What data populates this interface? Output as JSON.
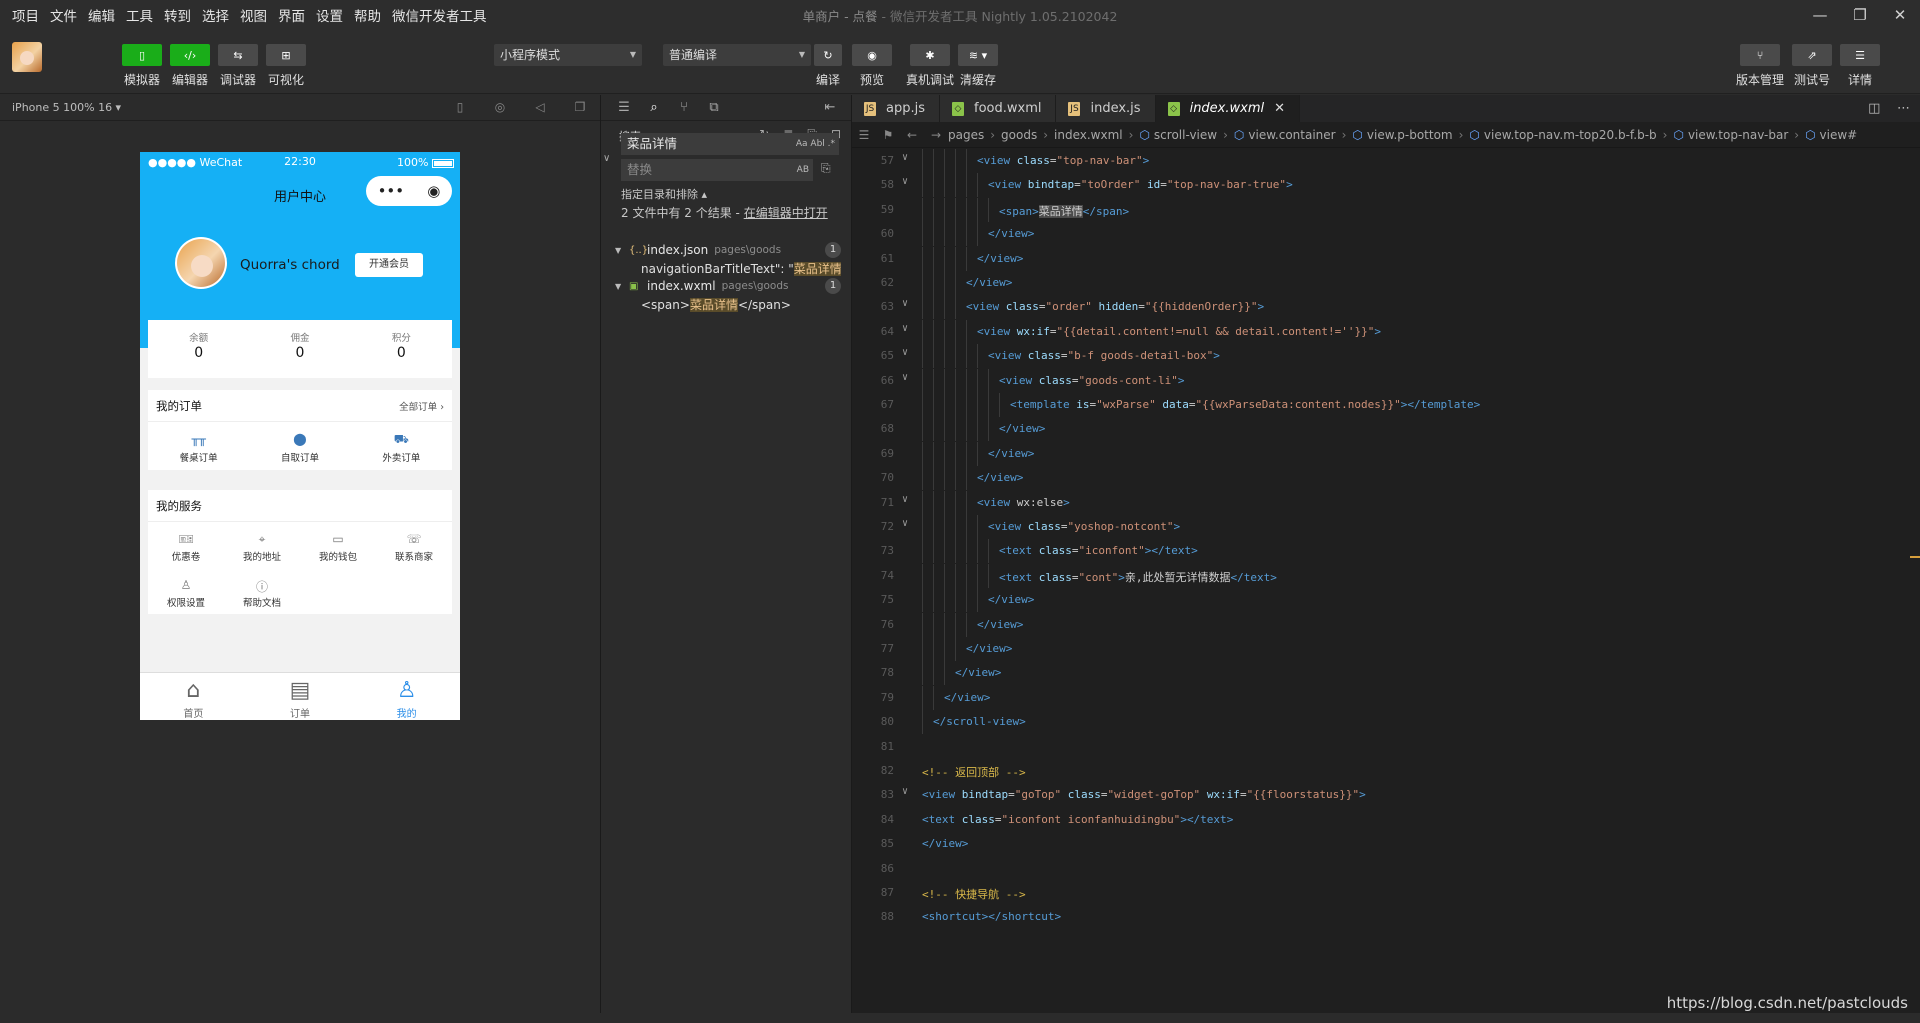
{
  "menubar": {
    "items": [
      "项目",
      "文件",
      "编辑",
      "工具",
      "转到",
      "选择",
      "视图",
      "界面",
      "设置",
      "帮助",
      "微信开发者工具"
    ],
    "title": "单商户 - 点餐",
    "title_suffix": "- 微信开发者工具 Nightly 1.05.2102042"
  },
  "toolbar": {
    "left_buttons": [
      {
        "label": "模拟器",
        "icon": "phone-icon"
      },
      {
        "label": "编辑器",
        "icon": "code-icon"
      },
      {
        "label": "调试器",
        "icon": "debug-icon"
      },
      {
        "label": "可视化",
        "icon": "layout-icon"
      }
    ],
    "mode_select": "小程序模式",
    "compile_select": "普通编译",
    "center_buttons": [
      {
        "label": "编译",
        "icon": "refresh-icon"
      },
      {
        "label": "预览",
        "icon": "eye-icon"
      },
      {
        "label": "真机调试",
        "icon": "bug-icon"
      },
      {
        "label": "清缓存",
        "icon": "layers-icon"
      }
    ],
    "right_buttons": [
      {
        "label": "版本管理",
        "icon": "branch-icon"
      },
      {
        "label": "测试号",
        "icon": "external-link-icon"
      },
      {
        "label": "详情",
        "icon": "menu-icon"
      }
    ]
  },
  "simulator": {
    "device": "iPhone 5 100% 16 ▾"
  },
  "phone": {
    "carrier": "●●●●● WeChat",
    "time": "22:30",
    "battery": "100%",
    "nav_title": "用户中心",
    "username": "Quorra's chord",
    "vip_button": "开通会员",
    "stats": [
      {
        "label": "余额",
        "value": "0"
      },
      {
        "label": "佣金",
        "value": "0"
      },
      {
        "label": "积分",
        "value": "0"
      }
    ],
    "orders": {
      "title": "我的订单",
      "more": "全部订单",
      "items": [
        {
          "label": "餐桌订单",
          "icon": "table-icon"
        },
        {
          "label": "自取订单",
          "icon": "bag-icon"
        },
        {
          "label": "外卖订单",
          "icon": "scooter-icon"
        }
      ]
    },
    "services": {
      "title": "我的服务",
      "items": [
        {
          "label": "优惠卷",
          "icon": "ticket-icon"
        },
        {
          "label": "我的地址",
          "icon": "location-icon"
        },
        {
          "label": "我的钱包",
          "icon": "wallet-icon"
        },
        {
          "label": "联系商家",
          "icon": "phone-call-icon"
        },
        {
          "label": "权限设置",
          "icon": "user-settings-icon"
        },
        {
          "label": "帮助文档",
          "icon": "help-icon"
        }
      ]
    },
    "tabbar": [
      {
        "label": "首页",
        "icon": "home-icon"
      },
      {
        "label": "订单",
        "icon": "clipboard-icon"
      },
      {
        "label": "我的",
        "icon": "user-icon",
        "active": true
      }
    ]
  },
  "search": {
    "header": "搜索",
    "query": "菜品详情",
    "query_options": "Aa Abl .*",
    "replace_placeholder": "替换",
    "replace_option": "AB",
    "scope_toggle": "指定目录和排除 ▴",
    "summary_prefix": "2 文件中有 2 个结果 - ",
    "summary_link": "在编辑器中打开",
    "results": [
      {
        "file": "index.json",
        "path": "pages\\goods",
        "count": "1",
        "line_before": "navigationBarTitleText\": \"",
        "match": "菜品详情",
        "line_after": "\","
      },
      {
        "file": "index.wxml",
        "path": "pages\\goods",
        "count": "1",
        "line_before": "<span>",
        "match": "菜品详情",
        "line_after": "</span>"
      }
    ]
  },
  "editor": {
    "tabs": [
      {
        "label": "app.js",
        "icon": "js-file-icon",
        "color": "#e5c07b"
      },
      {
        "label": "food.wxml",
        "icon": "wxml-file-icon",
        "color": "#8bc34a"
      },
      {
        "label": "index.js",
        "icon": "js-file-icon",
        "color": "#e5c07b"
      },
      {
        "label": "index.wxml",
        "icon": "wxml-file-icon",
        "color": "#8bc34a",
        "active": true
      }
    ],
    "breadcrumbs": [
      "pages",
      "goods",
      "index.wxml",
      "scroll-view",
      "view.container",
      "view.p-bottom",
      "view.top-nav.m-top20.b-f.b-b",
      "view.top-nav-bar",
      "view#"
    ],
    "lines": [
      {
        "n": "57",
        "fold": true,
        "html": "<view class=\"top-nav-bar\">"
      },
      {
        "n": "58",
        "fold": true,
        "html": "  <view bindtap=\"toOrder\" id=\"top-nav-bar-true\">"
      },
      {
        "n": "59",
        "fold": false,
        "html": "    <span>菜品详情</span>"
      },
      {
        "n": "60",
        "fold": false,
        "html": "  </view>"
      },
      {
        "n": "61",
        "fold": false,
        "html": "</view>"
      },
      {
        "n": "62",
        "fold": false,
        "html": "</view>"
      },
      {
        "n": "63",
        "fold": true,
        "html": "<view class=\"order\" hidden=\"{{hiddenOrder}}\">"
      },
      {
        "n": "64",
        "fold": true,
        "html": "  <view wx:if=\"{{detail.content!=null && detail.content!=''}}\">"
      },
      {
        "n": "65",
        "fold": true,
        "html": "    <view class=\"b-f goods-detail-box\">"
      },
      {
        "n": "66",
        "fold": true,
        "html": "      <view class=\"goods-cont-li\">"
      },
      {
        "n": "67",
        "fold": false,
        "html": "        <template is=\"wxParse\" data=\"{{wxParseData:content.nodes}}\"></template>"
      },
      {
        "n": "68",
        "fold": false,
        "html": "      </view>"
      },
      {
        "n": "69",
        "fold": false,
        "html": "    </view>"
      },
      {
        "n": "70",
        "fold": false,
        "html": "  </view>"
      },
      {
        "n": "71",
        "fold": true,
        "html": "  <view wx:else>"
      },
      {
        "n": "72",
        "fold": true,
        "html": "    <view class=\"yoshop-notcont\">"
      },
      {
        "n": "73",
        "fold": false,
        "html": "      <text class=\"iconfont\"></text>"
      },
      {
        "n": "74",
        "fold": false,
        "html": "      <text class=\"cont\">亲,此处暂无详情数据</text>"
      },
      {
        "n": "75",
        "fold": false,
        "html": "    </view>"
      },
      {
        "n": "76",
        "fold": false,
        "html": "  </view>"
      },
      {
        "n": "77",
        "fold": false,
        "html": "</view>"
      },
      {
        "n": "78",
        "fold": false,
        "html": "</view>"
      },
      {
        "n": "79",
        "fold": false,
        "html": "</view>"
      },
      {
        "n": "80",
        "fold": false,
        "html": "</scroll-view>"
      },
      {
        "n": "81",
        "fold": false,
        "html": ""
      },
      {
        "n": "82",
        "fold": false,
        "html": "<!-- 返回顶部 -->"
      },
      {
        "n": "83",
        "fold": true,
        "html": "<view bindtap=\"goTop\" class=\"widget-goTop\" wx:if=\"{{floorstatus}}\">"
      },
      {
        "n": "84",
        "fold": false,
        "html": "  <text class=\"iconfont iconfanhuidingbu\"></text>"
      },
      {
        "n": "85",
        "fold": false,
        "html": "</view>"
      },
      {
        "n": "86",
        "fold": false,
        "html": ""
      },
      {
        "n": "87",
        "fold": false,
        "html": "<!-- 快捷导航 -->"
      },
      {
        "n": "88",
        "fold": false,
        "html": "<shortcut></shortcut>"
      }
    ]
  },
  "watermark": "https://blog.csdn.net/pastclouds"
}
